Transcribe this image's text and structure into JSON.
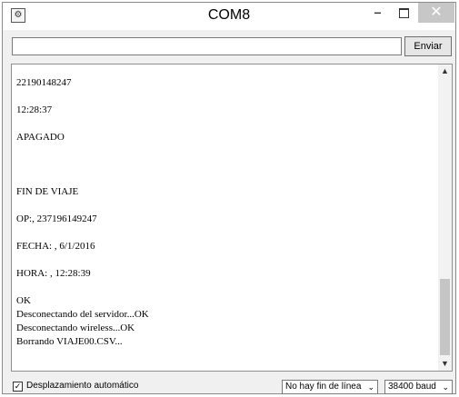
{
  "window": {
    "title": "COM8",
    "icon": "serial-monitor-icon",
    "minimize": "–",
    "close": "✕"
  },
  "input": {
    "value": "",
    "send_label": "Enviar"
  },
  "console": {
    "lines": [
      "22190148247",
      "",
      "12:28:37",
      "",
      "APAGADO",
      "",
      "",
      "",
      "FIN DE VIAJE",
      "",
      "OP:, 237196149247",
      "",
      "FECHA: , 6/1/2016",
      "",
      "HORA: , 12:28:39",
      "",
      "OK",
      "Desconectando del servidor...OK",
      "Desconectando wireless...OK",
      "Borrando VIAJE00.CSV..."
    ],
    "scroll_position_fraction": 0.78
  },
  "status": {
    "autoscroll_checked": true,
    "autoscroll_label": "Desplazamiento automático",
    "line_ending": "No hay fin de línea",
    "baud": "38400 baud",
    "dropdown_arrow": "⌄"
  }
}
